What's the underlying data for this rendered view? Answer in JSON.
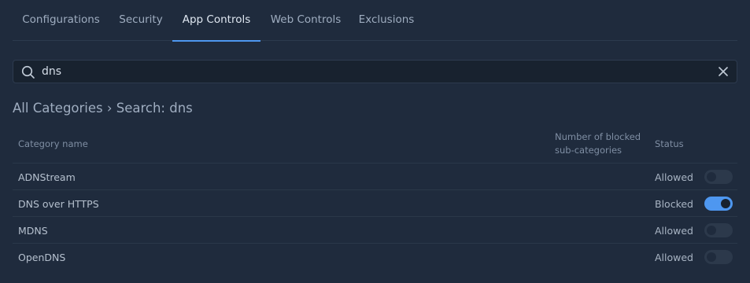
{
  "tabs": [
    {
      "label": "Configurations",
      "active": false
    },
    {
      "label": "Security",
      "active": false
    },
    {
      "label": "App Controls",
      "active": true
    },
    {
      "label": "Web Controls",
      "active": false
    },
    {
      "label": "Exclusions",
      "active": false
    }
  ],
  "search": {
    "value": "dns",
    "icon": "search-icon",
    "clear_icon": "close-icon"
  },
  "breadcrumb": "All Categories › Search: dns",
  "table": {
    "headers": {
      "name": "Category name",
      "blocked_line1": "Number of blocked",
      "blocked_line2": "sub-categories",
      "status": "Status"
    },
    "rows": [
      {
        "name": "ADNStream",
        "blocked_count": "",
        "status": "Allowed",
        "enabled": false
      },
      {
        "name": "DNS over HTTPS",
        "blocked_count": "",
        "status": "Blocked",
        "enabled": true
      },
      {
        "name": "MDNS",
        "blocked_count": "",
        "status": "Allowed",
        "enabled": false
      },
      {
        "name": "OpenDNS",
        "blocked_count": "",
        "status": "Allowed",
        "enabled": false
      }
    ]
  },
  "colors": {
    "background": "#1f2b3d",
    "accent": "#4e97f0",
    "toggle_off": "#2c394b"
  }
}
